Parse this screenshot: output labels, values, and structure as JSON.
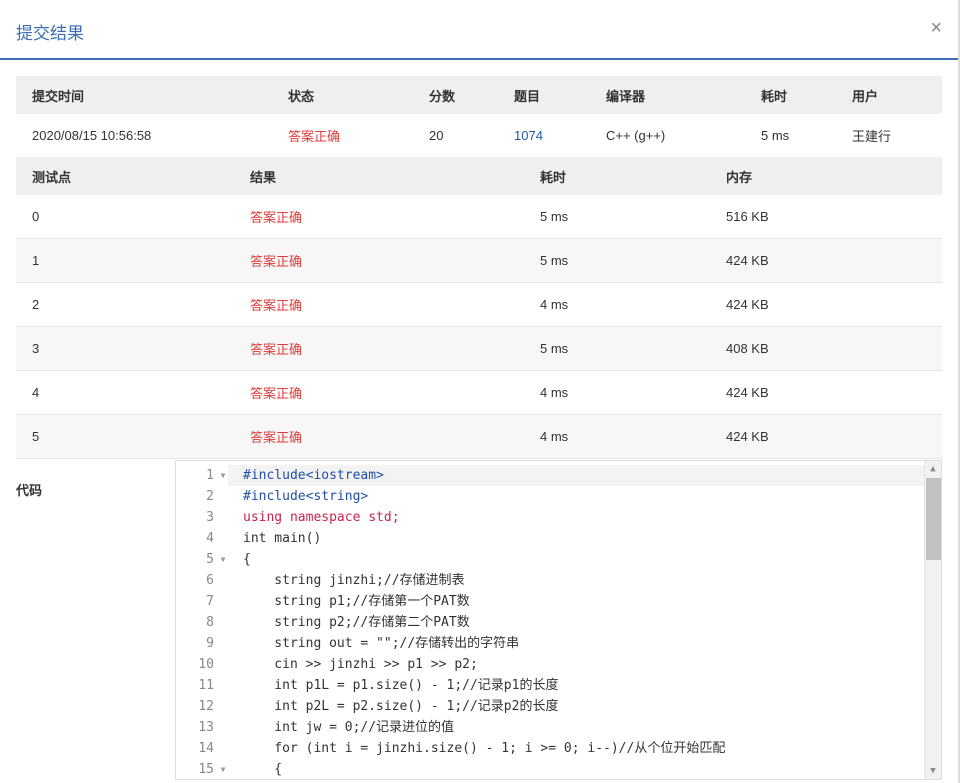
{
  "modal": {
    "title": "提交结果",
    "close": "×"
  },
  "summary": {
    "headers": [
      "提交时间",
      "状态",
      "分数",
      "题目",
      "编译器",
      "耗时",
      "用户"
    ],
    "row": [
      "2020/08/15 10:56:58",
      "答案正确",
      "20",
      "1074",
      "C++ (g++)",
      "5 ms",
      "王建行"
    ]
  },
  "tests": {
    "headers": [
      "测试点",
      "结果",
      "耗时",
      "内存"
    ],
    "rows": [
      [
        "0",
        "答案正确",
        "5 ms",
        "516 KB"
      ],
      [
        "1",
        "答案正确",
        "5 ms",
        "424 KB"
      ],
      [
        "2",
        "答案正确",
        "4 ms",
        "424 KB"
      ],
      [
        "3",
        "答案正确",
        "5 ms",
        "408 KB"
      ],
      [
        "4",
        "答案正确",
        "4 ms",
        "424 KB"
      ],
      [
        "5",
        "答案正确",
        "4 ms",
        "424 KB"
      ]
    ]
  },
  "code": {
    "label": "代码",
    "line_numbers": [
      "1",
      "2",
      "3",
      "4",
      "5",
      "6",
      "7",
      "8",
      "9",
      "10",
      "11",
      "12",
      "13",
      "14",
      "15"
    ],
    "lines": [
      "#include<iostream>",
      "#include<string>",
      "using namespace std;",
      "int main()",
      "{",
      "    string jinzhi;//存储进制表",
      "    string p1;//存储第一个PAT数",
      "    string p2;//存储第二个PAT数",
      "    string out = \"\";//存储转出的字符串",
      "    cin >> jinzhi >> p1 >> p2;",
      "    int p1L = p1.size() - 1;//记录p1的长度",
      "    int p2L = p2.size() - 1;//记录p2的长度",
      "    int jw = 0;//记录进位的值",
      "    for (int i = jinzhi.size() - 1; i >= 0; i--)//从个位开始匹配",
      "    {"
    ]
  }
}
